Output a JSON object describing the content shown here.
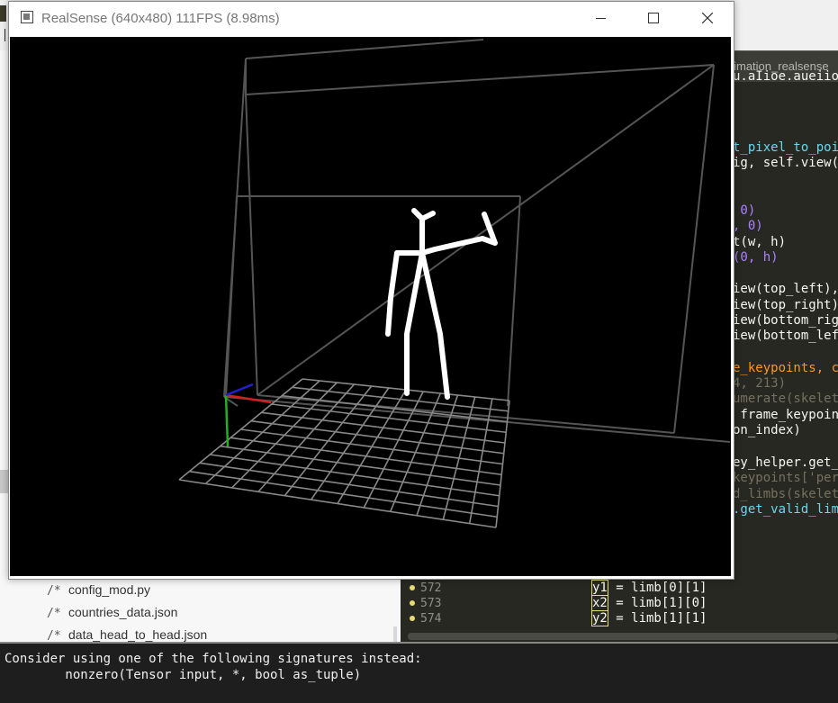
{
  "realsense_window": {
    "title": "RealSense (640x480) 111FPS (8.98ms)"
  },
  "editor": {
    "tab_title": "stimation_realsense",
    "lines": [
      {
        "text": "u.aIioe.aueiioIv.aueig",
        "color": "#f8f8f2"
      },
      {
        "text": "t_pixel_to_poi",
        "color": "#66d9ef"
      },
      {
        "text": "ig, self.view(",
        "color": "#f8f8f2"
      },
      {
        "text": " 0)",
        "color": "#ae81ff"
      },
      {
        "text": ", 0)",
        "color": "#ae81ff"
      },
      {
        "text": "t(w, h)",
        "color": "#f8f8f2"
      },
      {
        "text": "(0, h)",
        "color": "#ae81ff"
      },
      {
        "text": "iew(top_left),",
        "color": "#f8f8f2"
      },
      {
        "text": "iew(top_right)",
        "color": "#f8f8f2"
      },
      {
        "text": "iew(bottom_rig",
        "color": "#f8f8f2"
      },
      {
        "text": "iew(bottom_lef",
        "color": "#f8f8f2"
      },
      {
        "text": "e_keypoints, co",
        "color": "#fd971f"
      },
      {
        "text": "4, 213)",
        "color": "#75715e"
      },
      {
        "text": "umerate(skelet",
        "color": "#75715e"
      },
      {
        "text": " frame_keypoint",
        "color": "#f8f8f2"
      },
      {
        "text": "on_index)",
        "color": "#f8f8f2"
      },
      {
        "text": "ey_helper.get_",
        "color": "#f8f8f2"
      },
      {
        "text": "keypoints['per",
        "color": "#75715e"
      },
      {
        "text": "d_limbs(skelet",
        "color": "#75715e"
      },
      {
        "text": ".get_valid_lim",
        "color": "#66d9ef"
      }
    ],
    "numbered_lines": [
      {
        "number": "572",
        "var": "y1",
        "code": " = limb[0][1]"
      },
      {
        "number": "573",
        "var": "x2",
        "code": " = limb[1][0]"
      },
      {
        "number": "574",
        "var": "y2",
        "code": " = limb[1][1]"
      }
    ]
  },
  "explorer": {
    "files": [
      {
        "icon": "/*",
        "name": "config_mod.py"
      },
      {
        "icon": "/*",
        "name": "countries_data.json"
      },
      {
        "icon": "/*",
        "name": "data_head_to_head.json"
      }
    ]
  },
  "terminal": {
    "lines": [
      "Consider using one of the following signatures instead:",
      "        nonzero(Tensor input, *, bool as_tuple)"
    ]
  },
  "colors": {
    "editor_bg": "#272822",
    "terminal_bg": "#1e1e1e",
    "skeleton": "#ffffff",
    "room_lines": "#555555",
    "axis_x": "#d02020",
    "axis_y": "#20b020",
    "axis_z": "#2020d0"
  }
}
